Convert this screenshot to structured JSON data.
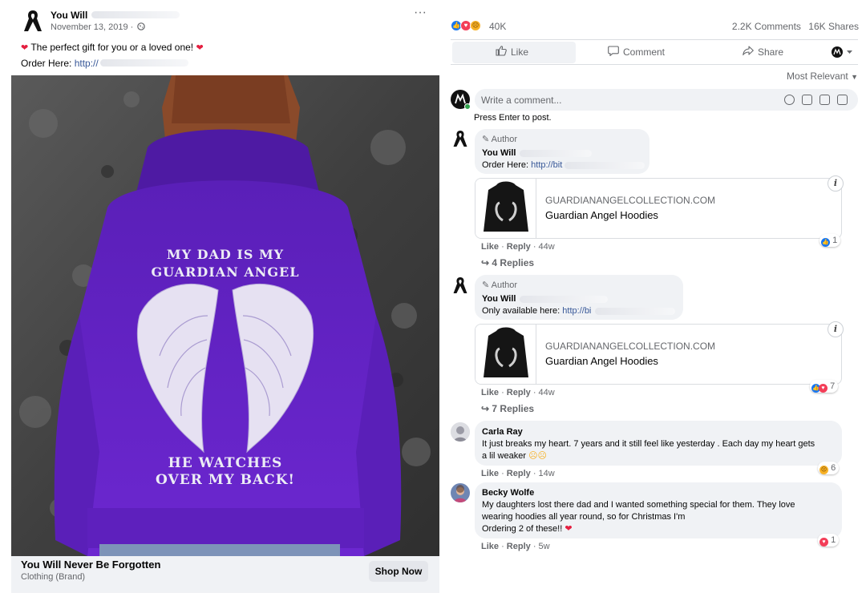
{
  "post": {
    "page_name": "You Will",
    "date": "November 13, 2019 ·",
    "more_label": "···",
    "text_line1": "The perfect gift for you or a loved one!",
    "text_line2_prefix": "Order Here:",
    "text_line2_link": "http://",
    "photo_text_top_1": "MY DAD IS MY",
    "photo_text_top_2": "GUARDIAN ANGEL",
    "photo_text_bottom_1": "HE WATCHES",
    "photo_text_bottom_2": "OVER MY BACK!",
    "ad_title": "You Will Never Be Forgotten",
    "ad_subtitle": "Clothing (Brand)",
    "shop_label": "Shop Now"
  },
  "engagement": {
    "reaction_count": "40K",
    "comments": "2.2K Comments",
    "shares": "16K Shares",
    "like_label": "Like",
    "comment_label": "Comment",
    "share_label": "Share",
    "sort_label": "Most Relevant"
  },
  "composer": {
    "placeholder": "Write a comment...",
    "hint": "Press Enter to post."
  },
  "comments": [
    {
      "badge": "Author",
      "name": "You Will",
      "line": "Order Here:",
      "link": "http://bit",
      "card_domain": "GUARDIANANGELCOLLECTION.COM",
      "card_title": "Guardian Angel Hoodies",
      "info": "i",
      "like": "Like",
      "reply": "Reply",
      "age": "· 44w",
      "reactions": "1",
      "replies": "4 Replies"
    },
    {
      "badge": "Author",
      "name": "You Will",
      "line": "Only available here:",
      "link": "http://bi",
      "card_domain": "GUARDIANANGELCOLLECTION.COM",
      "card_title": "Guardian Angel Hoodies",
      "info": "i",
      "like": "Like",
      "reply": "Reply",
      "age": "· 44w",
      "reactions": "7",
      "replies": "7 Replies"
    },
    {
      "name": "Carla Ray",
      "text_1": "It just breaks my heart. 7 years and it still feel like yesterday . Each day my heart gets",
      "text_2": "a lil weaker",
      "like": "Like",
      "reply": "Reply",
      "age": "· 14w",
      "reactions": "6"
    },
    {
      "name": "Becky Wolfe",
      "text_1": "My daughters lost there dad and I wanted something special for them. They love",
      "text_2": "wearing hoodies all year round, so for Christmas I'm",
      "text_3": "Ordering 2 of these!!",
      "like": "Like",
      "reply": "Reply",
      "age": "· 5w",
      "reactions": "1"
    }
  ],
  "colors": {
    "like_blue": "#1877f2",
    "love_red": "#f33e58",
    "haha_yellow": "#f7b125",
    "hoodie_purple": "#6a24c9",
    "link_blue": "#385898"
  }
}
